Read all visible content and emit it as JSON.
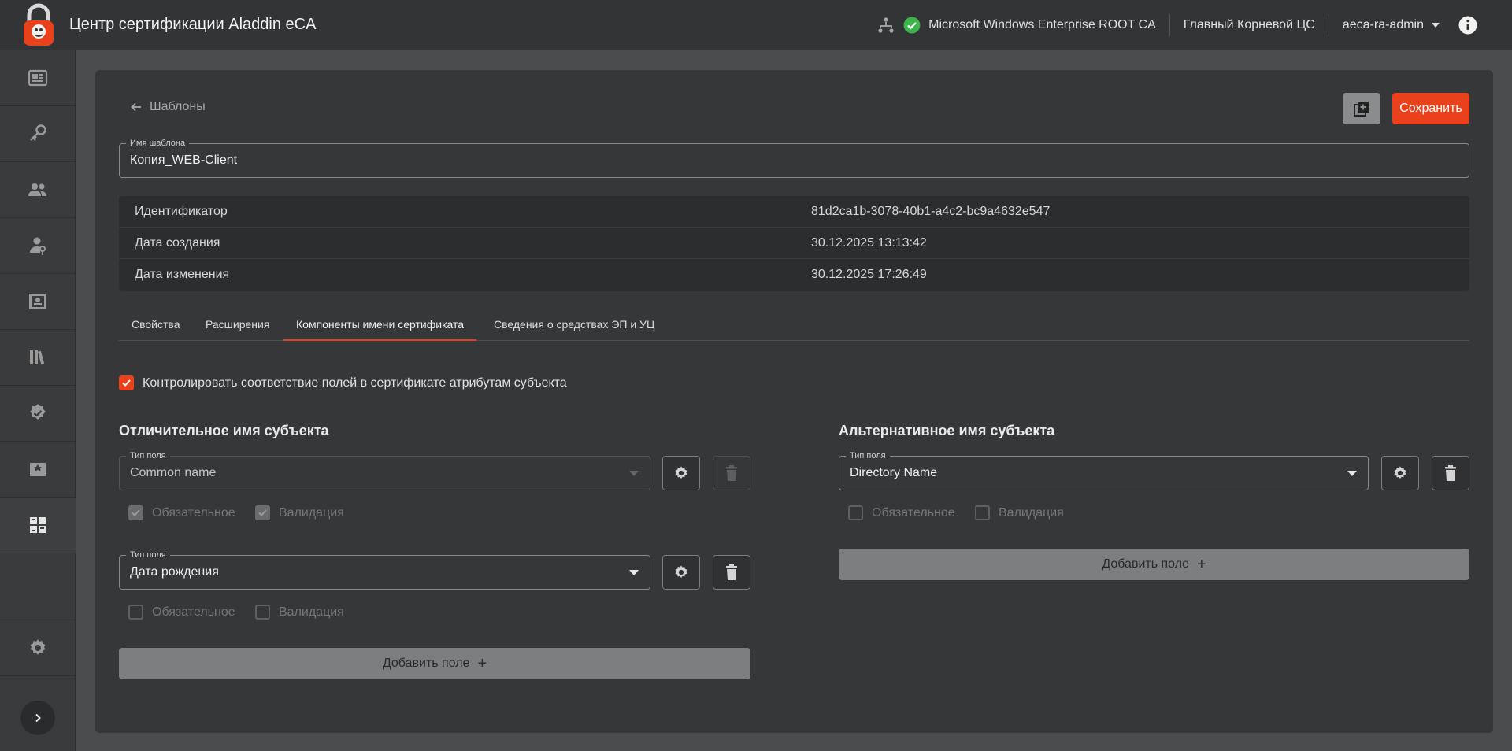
{
  "app": {
    "title": "Центр сертификации Aladdin eCA",
    "ca_name": "Microsoft Windows Enterprise ROOT CA",
    "ca_role": "Главный Корневой ЦС",
    "user": "aeca-ra-admin"
  },
  "header": {
    "back_label": "Шаблоны",
    "save_label": "Сохранить"
  },
  "template_name": {
    "label": "Имя шаблона",
    "value": "Копия_WEB-Client"
  },
  "info": {
    "rows": [
      {
        "key": "Идентификатор",
        "value": "81d2ca1b-3078-40b1-a4c2-bc9a4632e547"
      },
      {
        "key": "Дата создания",
        "value": "30.12.2025 13:13:42"
      },
      {
        "key": "Дата изменения",
        "value": "30.12.2025 17:26:49"
      }
    ]
  },
  "tabs": [
    {
      "label": "Свойства"
    },
    {
      "label": "Расширения"
    },
    {
      "label": "Компоненты имени сертификата",
      "active": true
    },
    {
      "label": "Сведения о средствах ЭП и УЦ"
    }
  ],
  "control_checkbox": {
    "label": "Контролировать соответствие полей в сертификате атрибутам субъекта",
    "checked": true
  },
  "subject_dn": {
    "title": "Отличительное имя субъекта",
    "fields": [
      {
        "label": "Тип поля",
        "value": "Common name",
        "required_label": "Обязательное",
        "validation_label": "Валидация",
        "required": true,
        "validation": true,
        "disabled": true
      },
      {
        "label": "Тип поля",
        "value": "Дата рождения",
        "required_label": "Обязательное",
        "validation_label": "Валидация",
        "required": false,
        "validation": false,
        "disabled": false
      }
    ],
    "add_label": "Добавить поле"
  },
  "subject_alt": {
    "title": "Альтернативное имя субъекта",
    "fields": [
      {
        "label": "Тип поля",
        "value": "Directory Name",
        "required_label": "Обязательное",
        "validation_label": "Валидация",
        "required": false,
        "validation": false,
        "disabled": false
      }
    ],
    "add_label": "Добавить поле"
  },
  "colors": {
    "accent": "#e8411b",
    "status_ok": "#3cb44b",
    "background": "#4b4c4d",
    "card": "#363738"
  },
  "icons": {
    "sidebar": [
      "dashboard-icon",
      "keys-icon",
      "users-icon",
      "user-key-icon",
      "certificate-request-icon",
      "library-icon",
      "verified-icon",
      "certificate-template-icon",
      "templates-grid-icon",
      "settings-icon"
    ]
  }
}
